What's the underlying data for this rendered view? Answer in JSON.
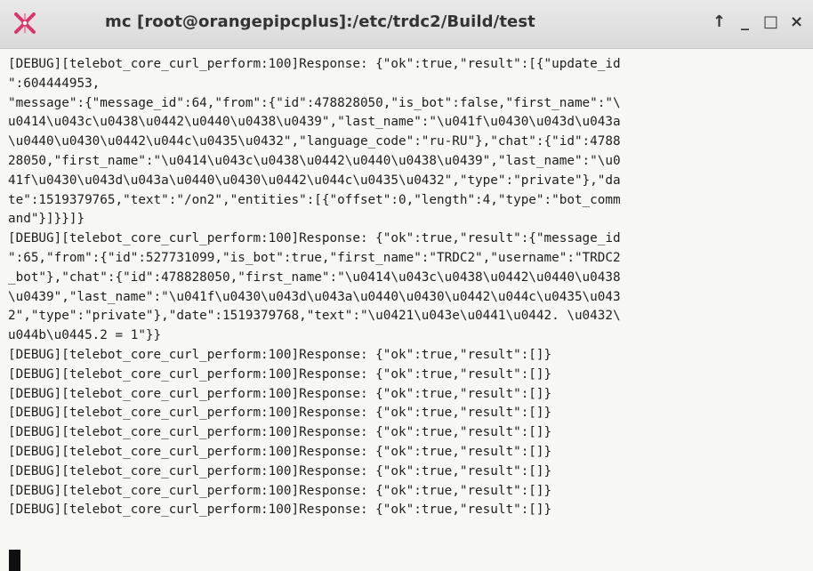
{
  "window": {
    "title": "mc [root@orangepipcplus]:/etc/trdc2/Build/test",
    "controls": [
      "↑",
      "_",
      "□",
      "×"
    ]
  },
  "icons": {
    "app": "app-icon",
    "up": "arrow-up-icon",
    "minimize": "minimize-icon",
    "maximize": "maximize-icon",
    "close": "close-icon"
  },
  "colors": {
    "titlebar": "#dedede",
    "terminal_background": "#f7f7f4",
    "text": "#1e1e1e",
    "app_icon": "#d9366e"
  },
  "terminal": {
    "lines": [
      "[DEBUG][telebot_core_curl_perform:100]Response: {\"ok\":true,\"result\":[{\"update_id",
      "\":604444953,",
      "\"message\":{\"message_id\":64,\"from\":{\"id\":478828050,\"is_bot\":false,\"first_name\":\"\\",
      "u0414\\u043c\\u0438\\u0442\\u0440\\u0438\\u0439\",\"last_name\":\"\\u041f\\u0430\\u043d\\u043a",
      "\\u0440\\u0430\\u0442\\u044c\\u0435\\u0432\",\"language_code\":\"ru-RU\"},\"chat\":{\"id\":4788",
      "28050,\"first_name\":\"\\u0414\\u043c\\u0438\\u0442\\u0440\\u0438\\u0439\",\"last_name\":\"\\u0",
      "41f\\u0430\\u043d\\u043a\\u0440\\u0430\\u0442\\u044c\\u0435\\u0432\",\"type\":\"private\"},\"da",
      "te\":1519379765,\"text\":\"/on2\",\"entities\":[{\"offset\":0,\"length\":4,\"type\":\"bot_comm",
      "and\"}]}}]}",
      "[DEBUG][telebot_core_curl_perform:100]Response: {\"ok\":true,\"result\":{\"message_id",
      "\":65,\"from\":{\"id\":527731099,\"is_bot\":true,\"first_name\":\"TRDC2\",\"username\":\"TRDC2",
      "_bot\"},\"chat\":{\"id\":478828050,\"first_name\":\"\\u0414\\u043c\\u0438\\u0442\\u0440\\u0438",
      "\\u0439\",\"last_name\":\"\\u041f\\u0430\\u043d\\u043a\\u0440\\u0430\\u0442\\u044c\\u0435\\u043",
      "2\",\"type\":\"private\"},\"date\":1519379768,\"text\":\"\\u0421\\u043e\\u0441\\u0442. \\u0432\\",
      "u044b\\u0445.2 = 1\"}}",
      "[DEBUG][telebot_core_curl_perform:100]Response: {\"ok\":true,\"result\":[]}",
      "[DEBUG][telebot_core_curl_perform:100]Response: {\"ok\":true,\"result\":[]}",
      "[DEBUG][telebot_core_curl_perform:100]Response: {\"ok\":true,\"result\":[]}",
      "[DEBUG][telebot_core_curl_perform:100]Response: {\"ok\":true,\"result\":[]}",
      "[DEBUG][telebot_core_curl_perform:100]Response: {\"ok\":true,\"result\":[]}",
      "[DEBUG][telebot_core_curl_perform:100]Response: {\"ok\":true,\"result\":[]}",
      "[DEBUG][telebot_core_curl_perform:100]Response: {\"ok\":true,\"result\":[]}",
      "[DEBUG][telebot_core_curl_perform:100]Response: {\"ok\":true,\"result\":[]}",
      "[DEBUG][telebot_core_curl_perform:100]Response: {\"ok\":true,\"result\":[]}"
    ]
  }
}
